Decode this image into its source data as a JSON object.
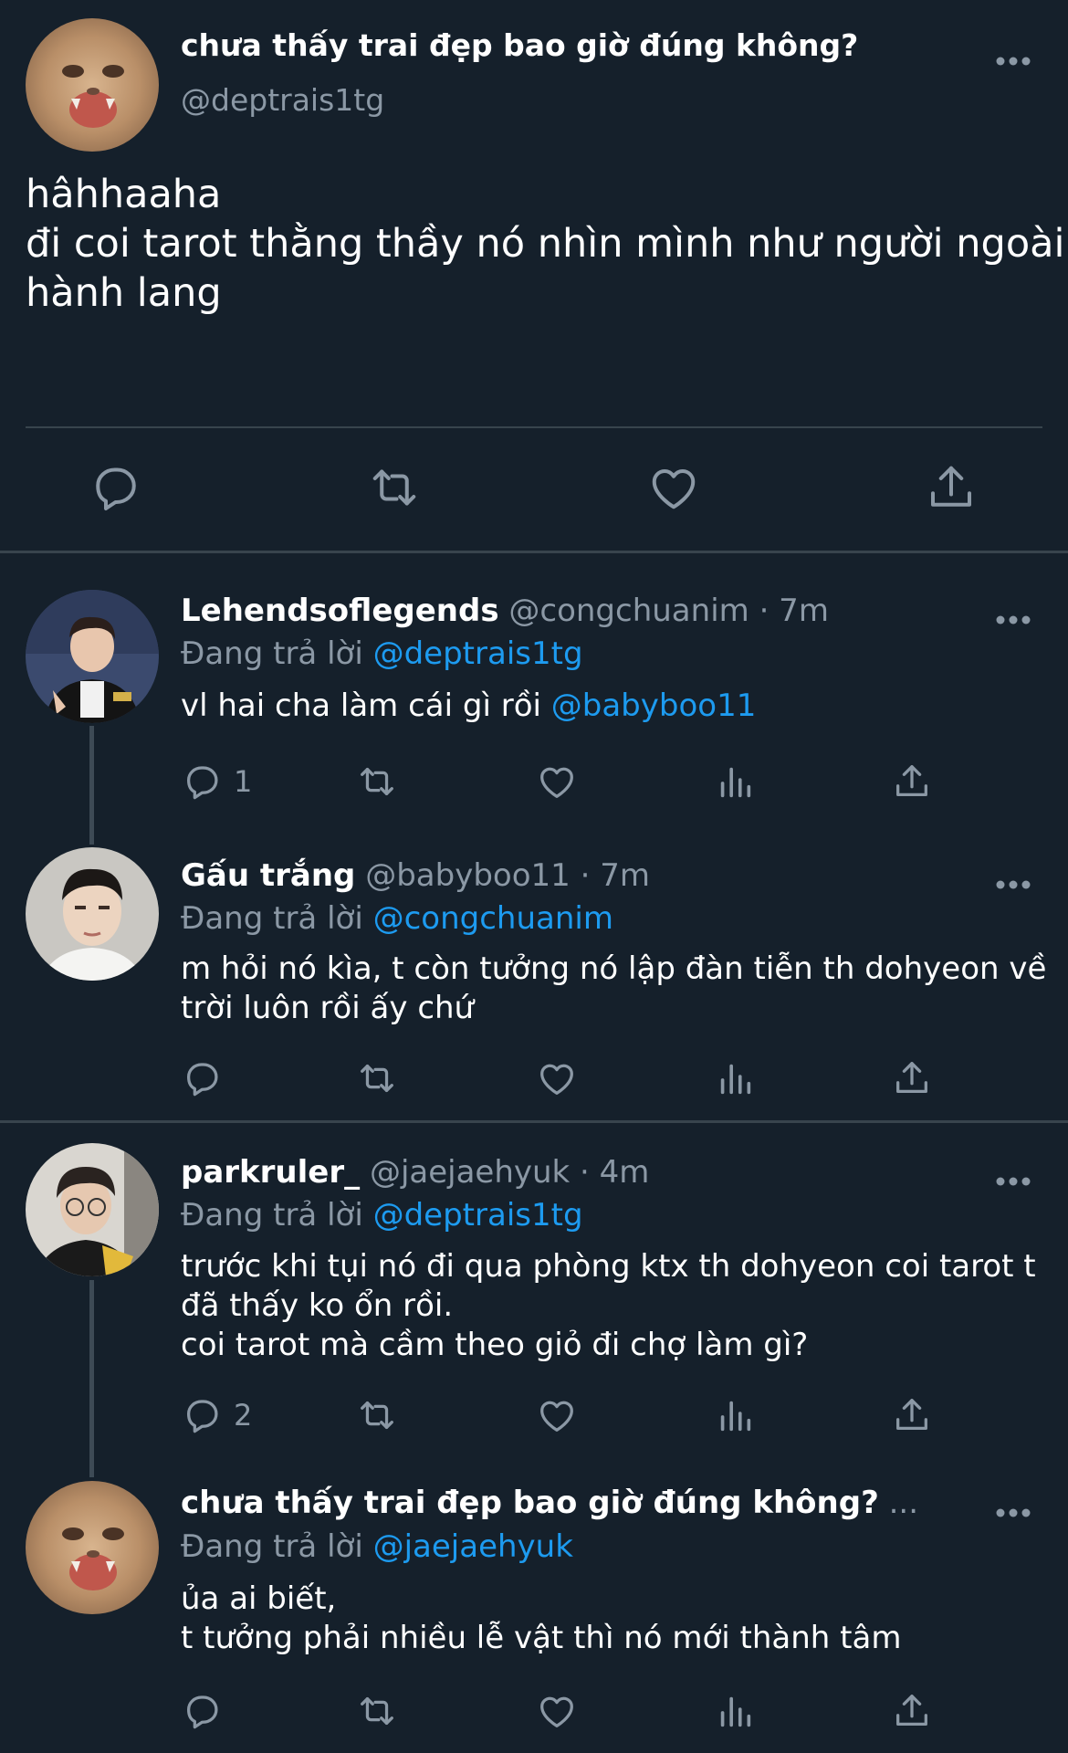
{
  "colors": {
    "background": "#15202b",
    "text": "#ffffff",
    "muted": "#8b98a5",
    "link": "#1d9bf0",
    "divider": "#38444d"
  },
  "main_tweet": {
    "display_name": "chưa thấy trai đẹp bao giờ đúng không?",
    "handle": "@deptrais1tg",
    "text_lines": [
      "hâhhaaha",
      "đi coi tarot thằng thầy nó nhìn mình như người ngoài",
      "hành lang"
    ],
    "actions": [
      "reply-icon",
      "retweet-icon",
      "like-icon",
      "share-icon"
    ]
  },
  "replies": [
    {
      "display_name": "Lehendsoflegends",
      "meta": "@congchuanim · 7m",
      "replying_label": "Đang trả lời",
      "replying_to": "@deptrais1tg",
      "text_lines": [
        {
          "text": "vl hai cha làm cái gì rồi ",
          "mention": "@babyboo11"
        }
      ],
      "reply_count": "1"
    },
    {
      "display_name": "Gấu trắng",
      "meta": "@babyboo11 · 7m",
      "replying_label": "Đang trả lời",
      "replying_to": "@congchuanim",
      "text_lines": [
        {
          "text": "m hỏi nó kìa, t còn tưởng nó lập đàn tiễn th dohyeon về",
          "mention": ""
        },
        {
          "text": "trời luôn rồi ấy chứ",
          "mention": ""
        }
      ],
      "reply_count": ""
    },
    {
      "display_name": "parkruler_",
      "meta": "@jaejaehyuk · 4m",
      "replying_label": "Đang trả lời",
      "replying_to": "@deptrais1tg",
      "text_lines": [
        {
          "text": "trước khi tụi nó đi qua phòng ktx th dohyeon coi tarot t",
          "mention": ""
        },
        {
          "text": "đã thấy ko ổn rồi.",
          "mention": ""
        },
        {
          "text": "coi tarot mà cầm theo giỏ đi chợ làm gì?",
          "mention": ""
        }
      ],
      "reply_count": "2"
    },
    {
      "display_name": "chưa thấy trai đẹp bao giờ đúng không?",
      "meta": "...",
      "replying_label": "Đang trả lời",
      "replying_to": "@jaejaehyuk",
      "text_lines": [
        {
          "text": "ủa ai biết,",
          "mention": ""
        },
        {
          "text": "t tưởng phải nhiều lễ vật thì nó mới thành tâm",
          "mention": ""
        }
      ],
      "reply_count": ""
    }
  ]
}
